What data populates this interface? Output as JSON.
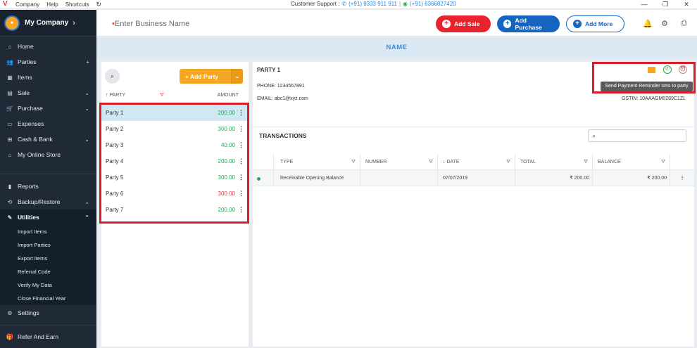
{
  "titlebar": {
    "menu": [
      "Company",
      "Help",
      "Shortcuts"
    ],
    "support_label": "Customer Support :",
    "phone": "(+91) 9333 911 911",
    "separator": "|",
    "whatsapp": "(+91) 6366827420",
    "minimize": "—",
    "restore": "❐",
    "close": "✕"
  },
  "sidebar": {
    "company_name": "My Company",
    "items": [
      {
        "label": "Home",
        "icon": "home-icon"
      },
      {
        "label": "Parties",
        "icon": "users-icon",
        "right": "+"
      },
      {
        "label": "Items",
        "icon": "items-icon"
      },
      {
        "label": "Sale",
        "icon": "sale-icon",
        "right": "⌄"
      },
      {
        "label": "Purchase",
        "icon": "cart-icon",
        "right": "⌄"
      },
      {
        "label": "Expenses",
        "icon": "expenses-icon"
      },
      {
        "label": "Cash & Bank",
        "icon": "bank-icon",
        "right": "⌄"
      },
      {
        "label": "My Online Store",
        "icon": "store-icon"
      },
      {
        "label": "Reports",
        "icon": "reports-icon"
      },
      {
        "label": "Backup/Restore",
        "icon": "backup-icon",
        "right": "⌄"
      },
      {
        "label": "Utilities",
        "icon": "wrench-icon",
        "right": "⌃"
      }
    ],
    "utilities_sub": [
      "Import Items",
      "Import Parties",
      "Export Items",
      "Referral Code",
      "Verify My Data",
      "Close Financial Year"
    ],
    "settings": "Settings",
    "footer": "Refer And Earn"
  },
  "header": {
    "business_placeholder": "Enter Business Name",
    "add_sale": "Add Sale",
    "add_purchase": "Add Purchase",
    "add_more": "Add More"
  },
  "name_strip": "NAME",
  "party_panel": {
    "add_party": "Add Party",
    "col_party": "PARTY",
    "col_amount": "AMOUNT",
    "parties": [
      {
        "name": "Party 1",
        "amount": "200.00",
        "color": "#1aaa55"
      },
      {
        "name": "Party 2",
        "amount": "300.00",
        "color": "#1aaa55"
      },
      {
        "name": "Party 3",
        "amount": "40.00",
        "color": "#1aaa55"
      },
      {
        "name": "Party 4",
        "amount": "200.00",
        "color": "#1aaa55"
      },
      {
        "name": "Party 5",
        "amount": "300.00",
        "color": "#1aaa55"
      },
      {
        "name": "Party 6",
        "amount": "300.00",
        "color": "#e53935"
      },
      {
        "name": "Party 7",
        "amount": "200.00",
        "color": "#1aaa55"
      }
    ]
  },
  "detail": {
    "party_title": "PARTY 1",
    "phone": "PHONE: 1234567891",
    "email": "EMAIL: abc1@xyz.com",
    "gstin": "GSTIN: 10AAAGM0289C1ZL",
    "tooltip": "Send Payment Reminder sms to party"
  },
  "transactions": {
    "title": "TRANSACTIONS",
    "columns": [
      "TYPE",
      "NUMBER",
      "DATE",
      "TOTAL",
      "BALANCE"
    ],
    "rows": [
      {
        "type": "Receivable Opening Balance",
        "number": "",
        "date": "07/07/2019",
        "total": "₹ 200.00",
        "balance": "₹ 200.00"
      }
    ]
  }
}
